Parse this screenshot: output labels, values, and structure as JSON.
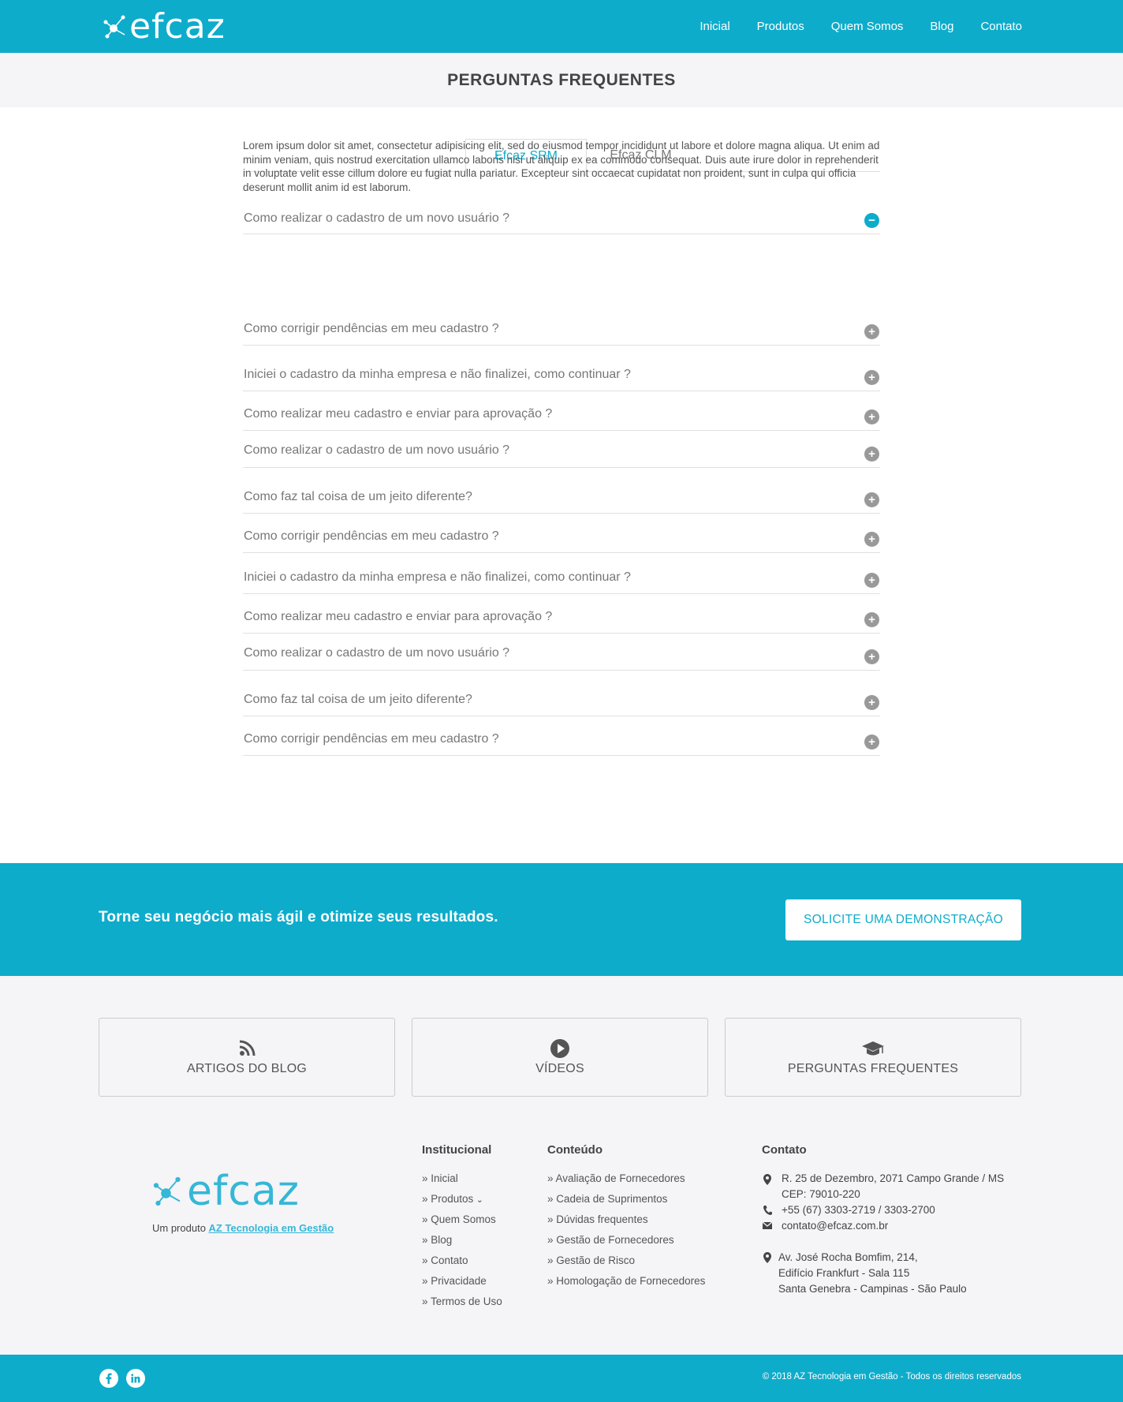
{
  "header": {
    "logo": "efcaz",
    "nav": [
      "Inicial",
      "Produtos",
      "Quem Somos",
      "Blog",
      "Contato"
    ]
  },
  "page_title": "PERGUNTAS FREQUENTES",
  "tabs": [
    {
      "label": "Efcaz SRM",
      "active": true
    },
    {
      "label": "Efcaz CLM",
      "active": false
    }
  ],
  "faq": {
    "open_answer": "Lorem ipsum dolor sit amet, consectetur adipisicing elit, sed do eiusmod tempor incididunt ut labore et dolore magna aliqua. Ut enim ad minim veniam, quis nostrud exercitation ullamco laboris nisi ut aliquip ex ea commodo consequat. Duis aute irure dolor in reprehenderit in voluptate velit esse cillum dolore eu fugiat nulla pariatur. Excepteur sint occaecat cupidatat non proident, sunt in culpa qui officia deserunt mollit anim id est laborum.",
    "questions": [
      "Como realizar o cadastro de um novo usuário ?",
      "Como corrigir pendências em meu cadastro ?",
      "Iniciei o cadastro da minha empresa e não finalizei, como continuar ?",
      "Como realizar meu cadastro e enviar para aprovação ?",
      "Como realizar o cadastro de um novo usuário ?",
      "Como faz tal coisa de um jeito diferente?",
      "Como corrigir pendências em meu cadastro ?",
      "Iniciei o cadastro da minha empresa e não finalizei, como continuar ?",
      "Como realizar meu cadastro e enviar para aprovação ?",
      "Como realizar o cadastro de um novo usuário ?",
      "Como faz tal coisa de um jeito diferente?",
      "Como corrigir pendências em meu cadastro ?"
    ]
  },
  "cta": {
    "text": "Torne seu negócio mais ágil e otimize seus resultados.",
    "button": "SOLICITE UMA DEMONSTRAÇÃO"
  },
  "cards": [
    "ARTIGOS DO BLOG",
    "VÍDEOS",
    "PERGUNTAS FREQUENTES"
  ],
  "footer": {
    "logo": "efcaz",
    "sub_prefix": "Um produto ",
    "sub_link": "AZ Tecnologia em Gestão",
    "institucional": {
      "title": "Institucional",
      "items": [
        "» Inicial",
        "» Produtos",
        "» Quem Somos",
        "» Blog",
        "» Contato",
        "» Privacidade",
        "» Termos de Uso"
      ]
    },
    "conteudo": {
      "title": "Conteúdo",
      "items": [
        "» Avaliação de Fornecedores",
        "» Cadeia de Suprimentos",
        "» Dúvidas frequentes",
        "» Gestão de Fornecedores",
        "» Gestão de Risco",
        "» Homologação de Fornecedores"
      ]
    },
    "contato": {
      "title": "Contato",
      "address1_line1": "R. 25 de Dezembro, 2071 Campo Grande / MS",
      "address1_line2": "CEP: 79010-220",
      "phone": "+55 (67) 3303-2719 / 3303-2700",
      "email": "contato@efcaz.com.br",
      "address2_line1": "Av. José Rocha Bomfim, 214,",
      "address2_line2": "Edifício Frankfurt - Sala 115",
      "address2_line3": "Santa Genebra - Campinas - São Paulo"
    },
    "copyright": "© 2018 AZ Tecnologia em Gestão - Todos os direitos reservados"
  },
  "colors": {
    "brand": "#0eaccb",
    "logo_footer": "#35b7d6"
  }
}
